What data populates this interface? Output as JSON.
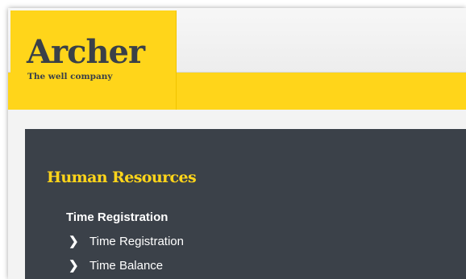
{
  "logo": {
    "wordmark": "Archer",
    "tagline": "The well company"
  },
  "menu": {
    "section_title": "Human Resources",
    "group_title": "Time Registration",
    "items": [
      {
        "label": "Time Registration",
        "icon": "chevron-right-icon"
      },
      {
        "label": "Time Balance",
        "icon": "chevron-right-icon"
      }
    ]
  },
  "colors": {
    "brand_yellow": "#ffd51a",
    "panel_dark": "#3b4149",
    "logo_text": "#3a4048"
  }
}
